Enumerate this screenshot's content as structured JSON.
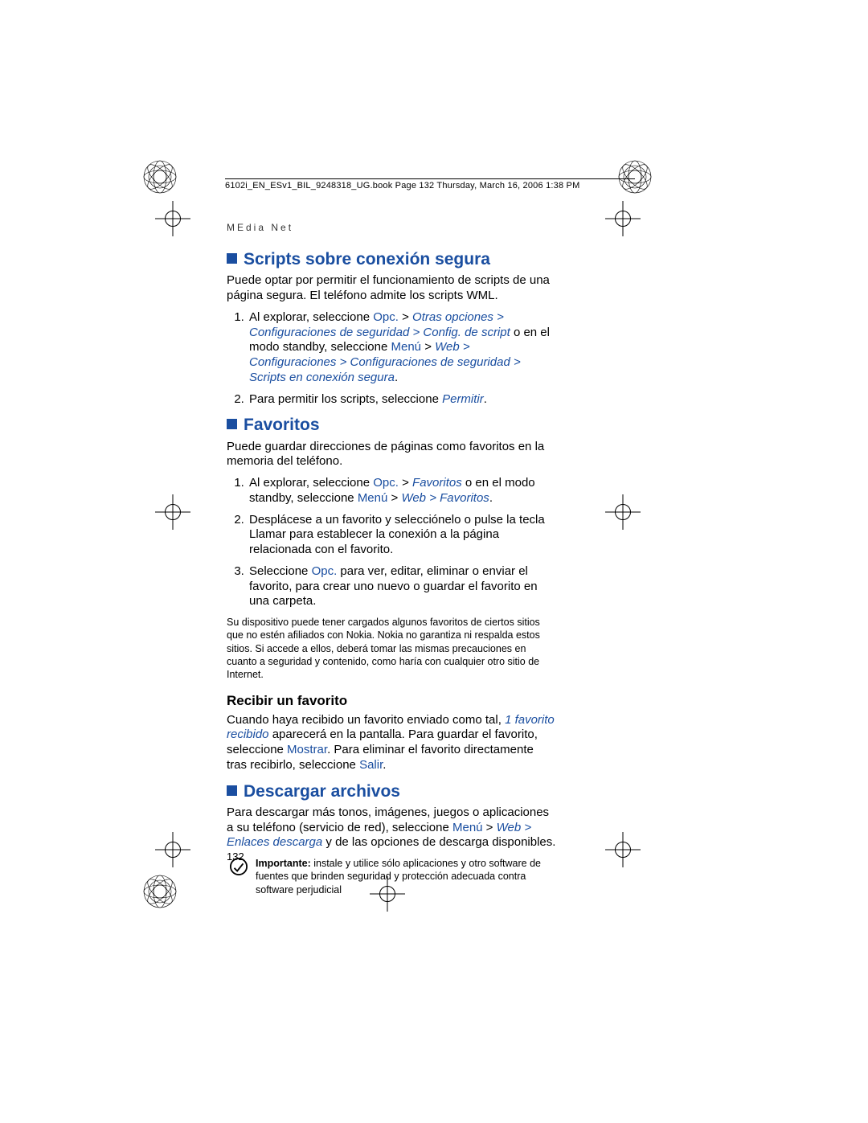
{
  "header_line": "6102i_EN_ESv1_BIL_9248318_UG.book  Page 132  Thursday, March 16, 2006  1:38 PM",
  "running_head": "MEdia Net",
  "page_number": "132",
  "s1": {
    "title": "Scripts sobre conexión segura",
    "intro": "Puede optar por permitir el funcionamiento de scripts de una página segura. El teléfono admite los scripts WML.",
    "li1_a": "Al explorar, seleccione ",
    "li1_opc": "Opc.",
    "li1_b": " > ",
    "li1_path1": "Otras opciones > Configuraciones de seguridad > Config. de script",
    "li1_c": " o en el modo standby, seleccione ",
    "li1_menu": "Menú",
    "li1_d": " > ",
    "li1_path2": "Web > Configuraciones > Configuraciones de seguridad > Scripts en conexión segura",
    "li1_e": ".",
    "li2_a": "Para permitir los scripts, seleccione ",
    "li2_perm": "Permitir",
    "li2_b": "."
  },
  "s2": {
    "title": "Favoritos",
    "intro": "Puede guardar direcciones de páginas como favoritos en la memoria del teléfono.",
    "li1_a": "Al explorar, seleccione ",
    "li1_opc": "Opc.",
    "li1_b": " > ",
    "li1_fav": "Favoritos",
    "li1_c": " o en el modo standby, seleccione ",
    "li1_menu": "Menú",
    "li1_d": " > ",
    "li1_path": "Web > Favoritos",
    "li1_e": ".",
    "li2": "Desplácese a un favorito y selecciónelo o pulse la tecla Llamar para establecer la conexión a la página relacionada con el favorito.",
    "li3_a": "Seleccione ",
    "li3_opc": "Opc.",
    "li3_b": " para ver, editar, eliminar o enviar el favorito, para crear uno nuevo o guardar el favorito en una carpeta.",
    "disclaimer": "Su dispositivo puede tener cargados algunos favoritos de ciertos sitios que no estén afiliados con Nokia. Nokia no garantiza ni respalda estos sitios. Si accede a ellos, deberá tomar las mismas precauciones en cuanto a seguridad y contenido, como haría con cualquier otro sitio de Internet.",
    "sub_title": "Recibir un favorito",
    "sub_a": "Cuando haya recibido un favorito enviado como tal, ",
    "sub_fav": "1 favorito recibido",
    "sub_b": " aparecerá en la pantalla. Para guardar el favorito, seleccione ",
    "sub_most": "Mostrar",
    "sub_c": ". Para eliminar el favorito directamente tras recibirlo, seleccione ",
    "sub_salir": "Salir",
    "sub_d": "."
  },
  "s3": {
    "title": "Descargar archivos",
    "p_a": "Para descargar más tonos, imágenes, juegos o aplicaciones a su teléfono (servicio de red), seleccione ",
    "p_menu": "Menú",
    "p_b": " > ",
    "p_path": "Web > Enlaces descarga",
    "p_c": " y de las opciones de descarga disponibles.",
    "note_label": "Importante:",
    "note_text": " instale y utilice sólo aplicaciones y otro software de fuentes que brinden seguridad y protección adecuada contra software perjudicial"
  }
}
